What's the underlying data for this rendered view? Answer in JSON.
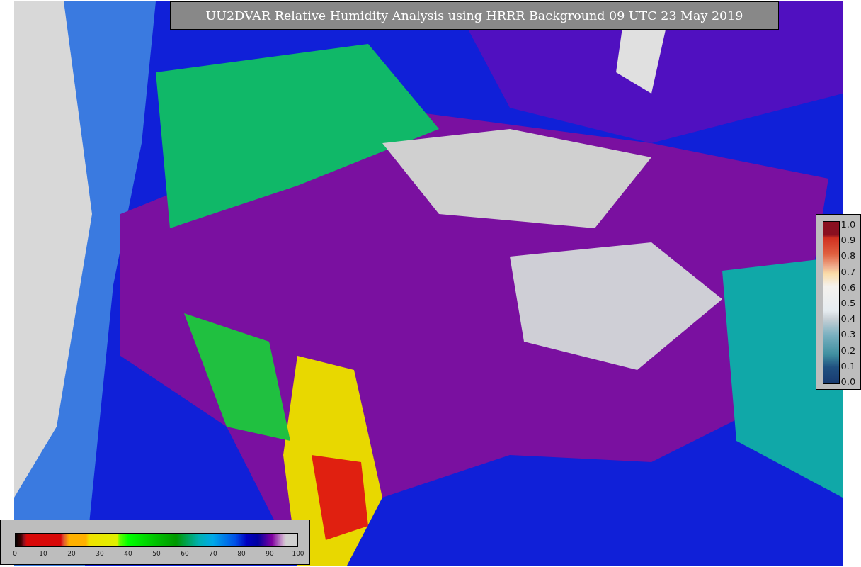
{
  "title": "UU2DVAR Relative Humidity Analysis using HRRR Background 09 UTC 23 May 2019",
  "humidity_colorbar": {
    "ticks": [
      "0",
      "10",
      "20",
      "30",
      "40",
      "50",
      "60",
      "70",
      "80",
      "90",
      "100"
    ]
  },
  "observation_colorbar": {
    "ticks": [
      "1.0",
      "0.9",
      "0.8",
      "0.7",
      "0.6",
      "0.5",
      "0.4",
      "0.3",
      "0.2",
      "0.1",
      "0.0"
    ]
  }
}
